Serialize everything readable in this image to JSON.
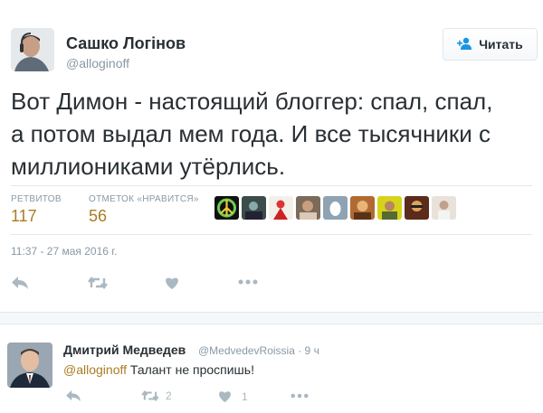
{
  "author": {
    "display_name": "Сашко Логінов",
    "handle": "@alloginoff"
  },
  "follow_button": {
    "label": "Читать"
  },
  "tweet": {
    "lines": [
      "Вот Димон - настоящий блоггер: спал, спал,",
      "а потом выдал мем года. И все тысячники с",
      "миллиониками утёрлись."
    ],
    "timestamp": "11:37 - 27 мая 2016 г."
  },
  "stats": {
    "retweets_label": "РЕТВИТОВ",
    "retweets_value": "117",
    "likes_label": "ОТМЕТОК «НРАВИТСЯ»",
    "likes_value": "56"
  },
  "liker_avatars": [
    "peace-sign-avatar",
    "photo-avatar",
    "illustration-avatar",
    "photo-avatar",
    "egg-avatar",
    "photo-avatar",
    "photo-avatar",
    "superhero-avatar",
    "photo-avatar"
  ],
  "actions": [
    "reply-icon",
    "retweet-icon",
    "like-icon",
    "more-icon"
  ],
  "reply": {
    "display_name": "Дмитрий Медведев",
    "handle": "@MedvedevRoissia · 9 ч",
    "mention": "@alloginoff",
    "text": " Талант не проспишь!",
    "retweet_count": "2",
    "like_count": "1"
  },
  "colors": {
    "text": "#292f33",
    "muted": "#8899a6",
    "accent": "#ab7b22",
    "divider": "#e1e8ed",
    "icon": "#aab8c2"
  }
}
